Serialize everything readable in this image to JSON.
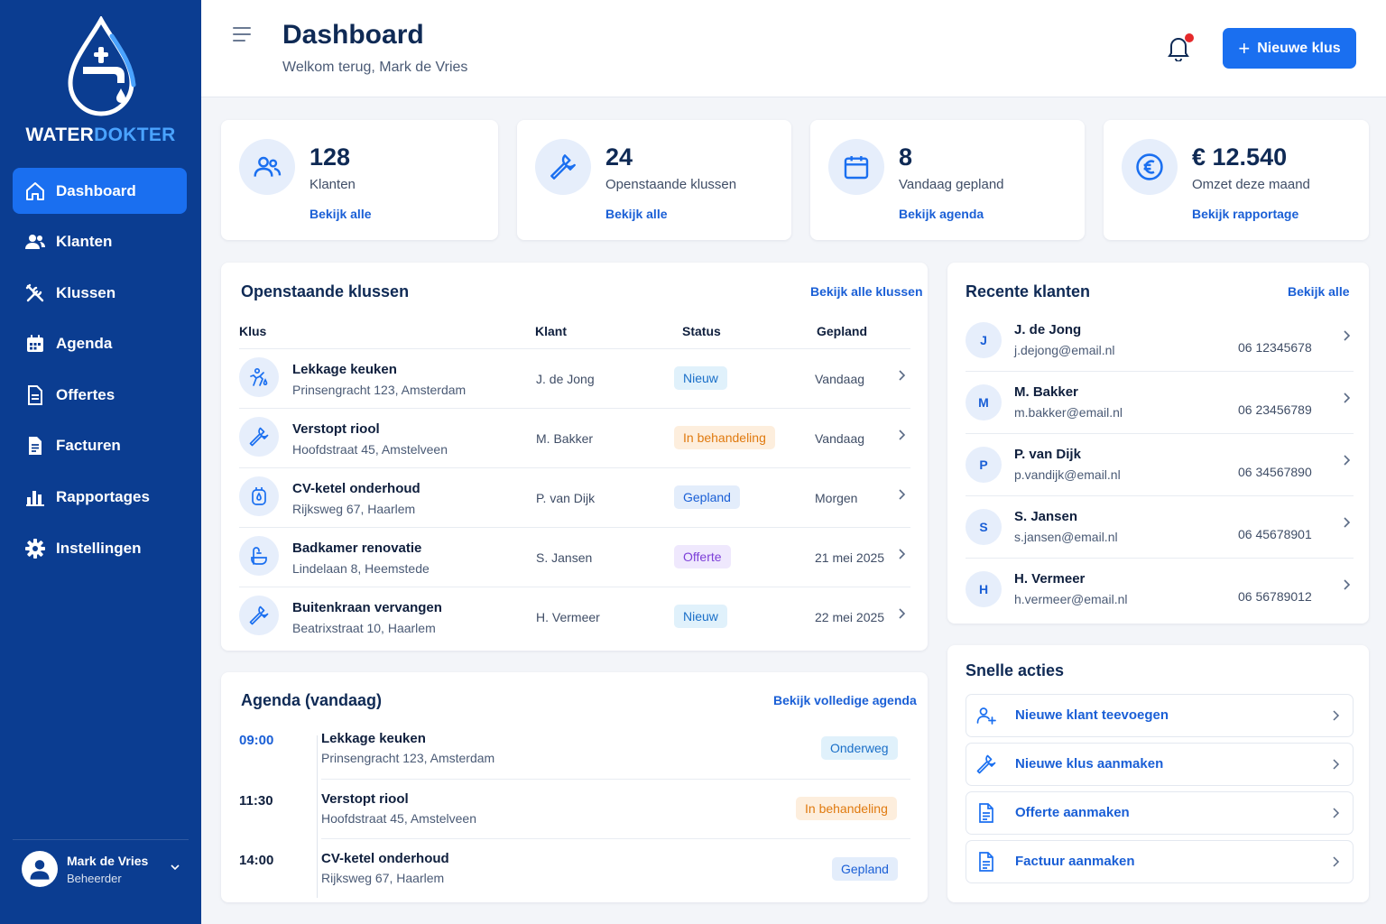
{
  "brand": {
    "part1": "WATER",
    "part2": "DOKTER",
    "accent": "#4aa3ff",
    "sidebar_bg": "#0b3d91",
    "primary": "#1a6ff0"
  },
  "sidebar": {
    "items": [
      {
        "label": "Dashboard",
        "icon": "home-icon",
        "active": true
      },
      {
        "label": "Klanten",
        "icon": "users-icon"
      },
      {
        "label": "Klussen",
        "icon": "tools-icon"
      },
      {
        "label": "Agenda",
        "icon": "calendar-icon"
      },
      {
        "label": "Offertes",
        "icon": "document-icon"
      },
      {
        "label": "Facturen",
        "icon": "invoice-icon"
      },
      {
        "label": "Rapportages",
        "icon": "bar-chart-icon"
      },
      {
        "label": "Instellingen",
        "icon": "gear-icon"
      }
    ],
    "user": {
      "name": "Mark de Vries",
      "role": "Beheerder"
    }
  },
  "header": {
    "title": "Dashboard",
    "subtitle": "Welkom terug, Mark de Vries",
    "new_button": "Nieuwe klus"
  },
  "stats": [
    {
      "value": "128",
      "label": "Klanten",
      "link": "Bekijk alle",
      "icon": "users-icon"
    },
    {
      "value": "24",
      "label": "Openstaande klussen",
      "link": "Bekijk alle",
      "icon": "wrench-icon"
    },
    {
      "value": "8",
      "label": "Vandaag gepland",
      "link": "Bekijk agenda",
      "icon": "calendar-icon"
    },
    {
      "value": "€ 12.540",
      "label": "Omzet deze maand",
      "link": "Bekijk rapportage",
      "icon": "euro-icon"
    }
  ],
  "jobs": {
    "title": "Openstaande klussen",
    "link": "Bekijk alle klussen",
    "columns": [
      "Klus",
      "Klant",
      "Status",
      "Gepland"
    ],
    "rows": [
      {
        "title": "Lekkage keuken",
        "address": "Prinsengracht 123, Amsterdam",
        "client": "J. de Jong",
        "status": "Nieuw",
        "date": "Vandaag",
        "icon": "leak-icon"
      },
      {
        "title": "Verstopt riool",
        "address": "Hoofdstraat 45, Amstelveen",
        "client": "M. Bakker",
        "status": "In behandeling",
        "date": "Vandaag",
        "icon": "wrench-icon"
      },
      {
        "title": "CV-ketel onderhoud",
        "address": "Rijksweg 67, Haarlem",
        "client": "P. van Dijk",
        "status": "Gepland",
        "date": "Morgen",
        "icon": "boiler-icon"
      },
      {
        "title": "Badkamer renovatie",
        "address": "Lindelaan 8, Heemstede",
        "client": "S. Jansen",
        "status": "Offerte",
        "date": "21 mei 2025",
        "icon": "bathroom-icon"
      },
      {
        "title": "Buitenkraan vervangen",
        "address": "Beatrixstraat 10, Haarlem",
        "client": "H. Vermeer",
        "status": "Nieuw",
        "date": "22 mei 2025",
        "icon": "wrench-icon"
      }
    ]
  },
  "agenda": {
    "title": "Agenda (vandaag)",
    "link": "Bekijk volledige agenda",
    "rows": [
      {
        "time": "09:00",
        "title": "Lekkage keuken",
        "address": "Prinsengracht 123, Amsterdam",
        "status": "Onderweg"
      },
      {
        "time": "11:30",
        "title": "Verstopt riool",
        "address": "Hoofdstraat 45, Amstelveen",
        "status": "In behandeling"
      },
      {
        "time": "14:00",
        "title": "CV-ketel onderhoud",
        "address": "Rijksweg 67, Haarlem",
        "status": "Gepland"
      }
    ]
  },
  "clients": {
    "title": "Recente klanten",
    "link": "Bekijk alle",
    "rows": [
      {
        "initial": "J",
        "name": "J. de Jong",
        "email": "j.dejong@email.nl",
        "phone": "06 12345678"
      },
      {
        "initial": "M",
        "name": "M. Bakker",
        "email": "m.bakker@email.nl",
        "phone": "06 23456789"
      },
      {
        "initial": "P",
        "name": "P. van Dijk",
        "email": "p.vandijk@email.nl",
        "phone": "06 34567890"
      },
      {
        "initial": "S",
        "name": "S. Jansen",
        "email": "s.jansen@email.nl",
        "phone": "06 45678901"
      },
      {
        "initial": "H",
        "name": "H. Vermeer",
        "email": "h.vermeer@email.nl",
        "phone": "06 56789012"
      }
    ]
  },
  "quick_actions": {
    "title": "Snelle acties",
    "items": [
      {
        "label": "Nieuwe klant teevoegen",
        "icon": "add-user-icon"
      },
      {
        "label": "Nieuwe klus aanmaken",
        "icon": "wrench-icon"
      },
      {
        "label": "Offerte aanmaken",
        "icon": "document-icon"
      },
      {
        "label": "Factuur aanmaken",
        "icon": "invoice-icon"
      }
    ]
  }
}
